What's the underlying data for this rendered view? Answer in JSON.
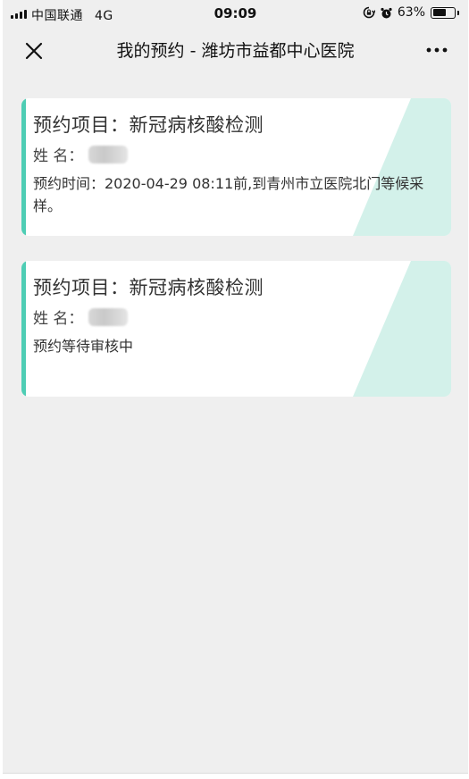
{
  "status_bar": {
    "carrier": "中国联通",
    "network": "4G",
    "time": "09:09",
    "battery": "63%",
    "battery_level": 0.63
  },
  "nav": {
    "title": "我的预约 - 潍坊市益都中心医院"
  },
  "colors": {
    "accent": "#4ecdb4",
    "accent_light": "#d3f1ea",
    "background": "#efefef",
    "card": "#ffffff"
  },
  "appointments": [
    {
      "title": "预约项目：新冠病核酸检测",
      "name_label": "姓  名：",
      "detail": "预约时间：2020-04-29 08:11前,到青州市立医院北门等候采样。"
    },
    {
      "title": "预约项目：新冠病核酸检测",
      "name_label": "姓  名：",
      "detail": "预约等待审核中"
    }
  ]
}
